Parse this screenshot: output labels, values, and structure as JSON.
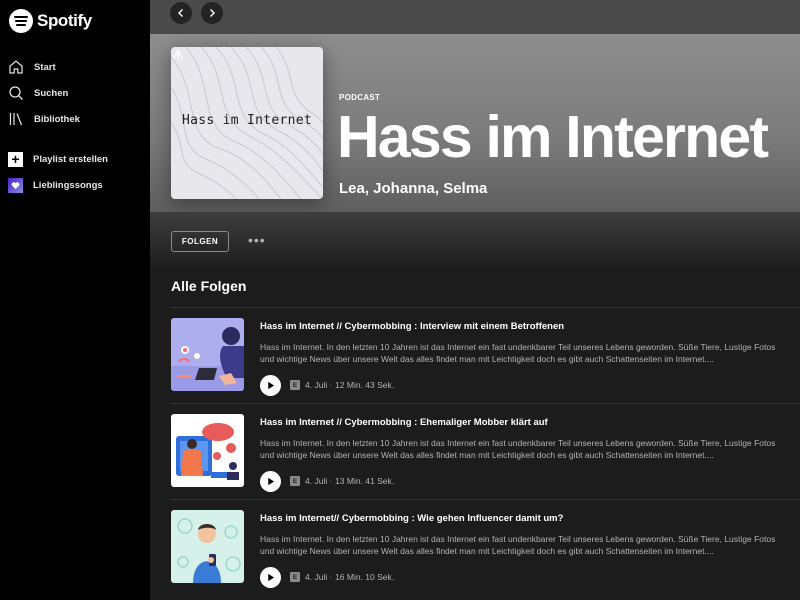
{
  "app": {
    "name": "Spotify"
  },
  "sidebar": {
    "nav": [
      {
        "label": "Start",
        "icon": "home-icon"
      },
      {
        "label": "Suchen",
        "icon": "search-icon"
      },
      {
        "label": "Bibliothek",
        "icon": "library-icon"
      }
    ],
    "library": [
      {
        "label": "Playlist erstellen",
        "icon": "plus-icon"
      },
      {
        "label": "Lieblingssongs",
        "icon": "heart-icon"
      }
    ]
  },
  "podcast": {
    "type_label": "PODCAST",
    "title": "Hass im Internet",
    "cover_title": "Hass im Internet",
    "authors": "Lea, Johanna, Selma",
    "follow_label": "FOLGEN",
    "more_label": "•••"
  },
  "episodes_section": {
    "title": "Alle Folgen",
    "items": [
      {
        "title": "Hass im Internet // Cybermobbing : Interview mit einem Betroffenen",
        "description": "Hass im Internet. In den letzten 10 Jahren ist das Internet ein fast undenkbarer Teil unseres Lebens geworden. Süße Tiere, Lustige Fotos und wichtige News über unsere Welt das alles findet man mit Leichtigkeit doch es gibt auch Schattenseiten im Internet....",
        "badge": "E",
        "date": "4. Juli",
        "duration": "12 Min. 43 Sek."
      },
      {
        "title": "Hass im Internet // Cybermobbing : Ehemaliger Mobber klärt auf",
        "description": "Hass im Internet. In den letzten 10 Jahren ist das Internet ein fast undenkbarer Teil unseres Lebens geworden. Süße Tiere, Lustige Fotos und wichtige News über unsere Welt das alles findet man mit Leichtigkeit doch es gibt auch Schattenseiten im Internet....",
        "badge": "E",
        "date": "4. Juli",
        "duration": "13 Min. 41 Sek."
      },
      {
        "title": "Hass im Internet// Cybermobbing : Wie gehen Influencer damit um?",
        "description": "Hass im Internet. In den letzten 10 Jahren ist das Internet ein fast undenkbarer Teil unseres Lebens geworden. Süße Tiere, Lustige Fotos und wichtige News über unsere Welt das alles findet man mit Leichtigkeit doch es gibt auch Schattenseiten im Internet....",
        "badge": "E",
        "date": "4. Juli",
        "duration": "16 Min. 10 Sek."
      }
    ],
    "meta_separator": "·"
  },
  "colors": {
    "sidebar_bg": "#000000",
    "hero_bg": "#8e8e8e",
    "content_bg": "#1c1c1c",
    "text_primary": "#ffffff",
    "text_secondary": "#b3b3b3"
  }
}
